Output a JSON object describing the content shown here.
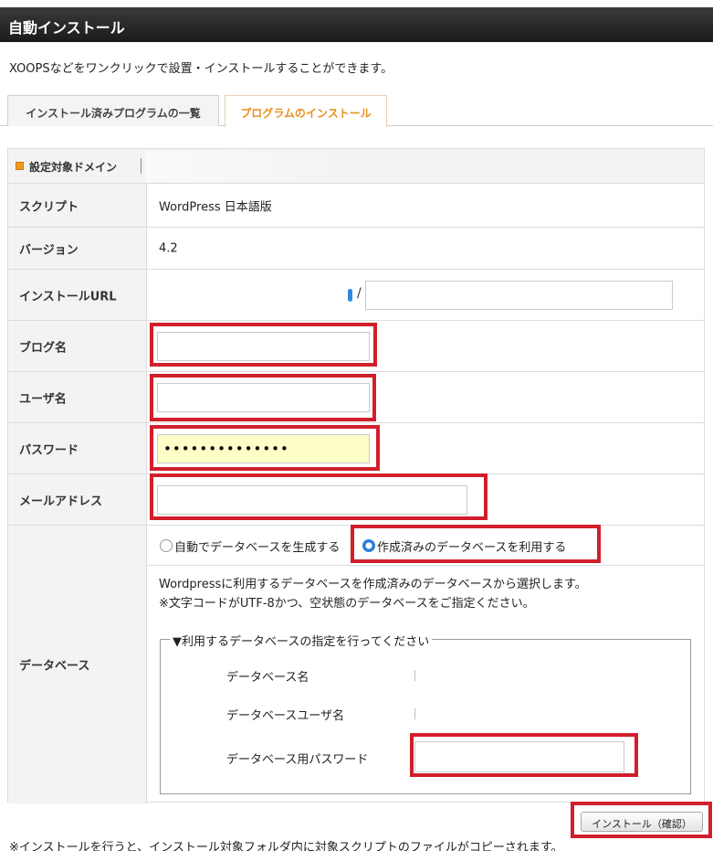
{
  "header": {
    "title": "自動インストール"
  },
  "description": "XOOPSなどをワンクリックで設置・インストールすることができます。",
  "tabs": [
    {
      "label": "インストール済みプログラムの一覧",
      "active": false
    },
    {
      "label": "プログラムのインストール",
      "active": true
    }
  ],
  "form": {
    "domain_label": "設定対象ドメイン",
    "rows": {
      "script": {
        "label": "スクリプト",
        "value": "WordPress 日本語版"
      },
      "version": {
        "label": "バージョン",
        "value": "4.2"
      },
      "url": {
        "label": "インストールURL",
        "slash": "/",
        "value": ""
      },
      "blog": {
        "label": "ブログ名",
        "value": ""
      },
      "user": {
        "label": "ユーザ名",
        "value": ""
      },
      "password": {
        "label": "パスワード",
        "value": "••••••••••••••"
      },
      "email": {
        "label": "メールアドレス",
        "value": ""
      },
      "database": {
        "label": "データベース",
        "option_auto": "自動でデータベースを生成する",
        "option_existing": "作成済みのデータベースを利用する",
        "selected": "option_existing",
        "help_line1": "Wordpressに利用するデータベースを作成済みのデータベースから選択します。",
        "help_line2": "※文字コードがUTF-8かつ、空状態のデータベースをご指定ください。",
        "fieldset_legend": "▼利用するデータベースの指定を行ってください",
        "db_name_label": "データベース名",
        "db_user_label": "データベースユーザ名",
        "db_password_label": "データベース用パスワード",
        "db_password_value": ""
      }
    },
    "confirm_button": "インストール（確認）"
  },
  "footnote": "※インストールを行うと、インストール対象フォルダ内に対象スクリプトのファイルがコピーされます。",
  "colors": {
    "highlight_red": "#d11f2c",
    "tab_active": "#e8901e",
    "radio_selected": "#2b7fd6",
    "password_bg": "#fdfdc8"
  }
}
